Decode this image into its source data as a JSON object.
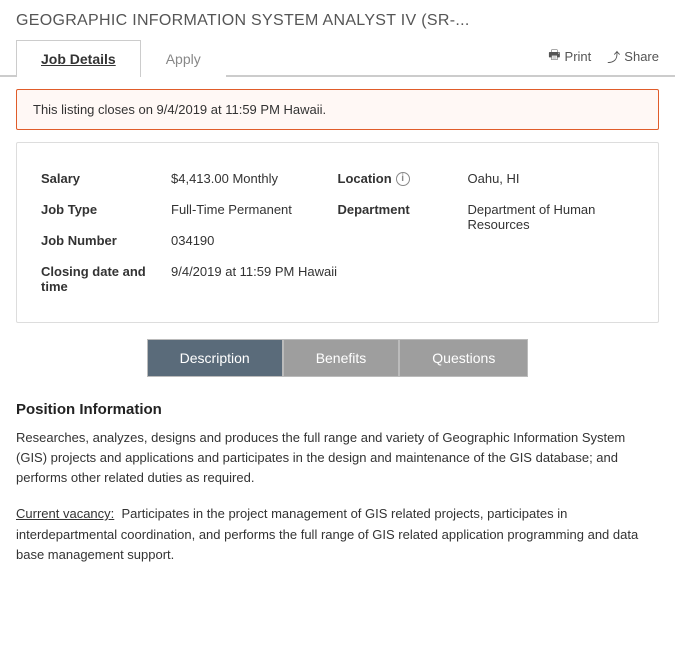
{
  "page": {
    "title": "GEOGRAPHIC INFORMATION SYSTEM ANALYST IV (SR-...",
    "tabs": [
      {
        "id": "job-details",
        "label": "Job Details",
        "active": true
      },
      {
        "id": "apply",
        "label": "Apply",
        "active": false
      }
    ],
    "actions": [
      {
        "id": "print",
        "label": "Print",
        "icon": "printer-icon"
      },
      {
        "id": "share",
        "label": "Share",
        "icon": "share-icon"
      }
    ],
    "notice": "This listing closes on 9/4/2019 at 11:59 PM Hawaii.",
    "job_info": {
      "salary_label": "Salary",
      "salary_value": "$4,413.00 Monthly",
      "location_label": "Location",
      "location_value": "Oahu, HI",
      "job_type_label": "Job Type",
      "job_type_value": "Full-Time Permanent",
      "department_label": "Department",
      "department_value": "Department of Human Resources",
      "job_number_label": "Job Number",
      "job_number_value": "034190",
      "closing_label": "Closing date and time",
      "closing_value": "9/4/2019 at 11:59 PM Hawaii"
    },
    "description_tabs": [
      {
        "id": "description",
        "label": "Description",
        "active": true
      },
      {
        "id": "benefits",
        "label": "Benefits",
        "active": false
      },
      {
        "id": "questions",
        "label": "Questions",
        "active": false
      }
    ],
    "content": {
      "section_title": "Position Information",
      "section_body": "Researches, analyzes, designs and produces the full range and variety of Geographic Information System (GIS) projects and applications and participates in the design and maintenance of the GIS database; and performs other related duties as required.",
      "vacancy_label": "Current vacancy:",
      "vacancy_body": "Participates in the project management of GIS related projects, participates in interdepartmental coordination, and performs the full range of GIS related application programming and data base management support."
    }
  }
}
